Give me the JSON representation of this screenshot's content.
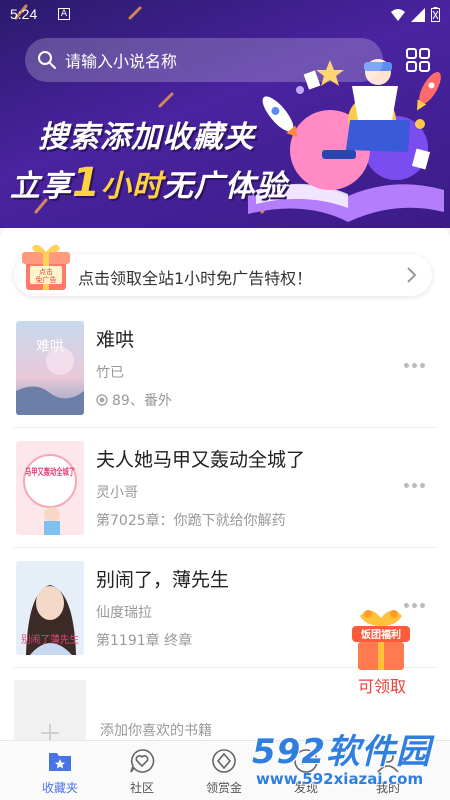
{
  "status_bar": {
    "time": "5:24",
    "notification": "A"
  },
  "search": {
    "placeholder": "请输入小说名称"
  },
  "banner": {
    "line1": "搜索添加收藏夹",
    "line2_prefix": "立享",
    "line2_number": "1",
    "line2_highlight": "小时",
    "line2_suffix": "无广体验"
  },
  "ad_privilege": {
    "badge_top": "点击",
    "badge_bottom": "免广告",
    "text": "点击领取全站1小时免广告特权！"
  },
  "books": [
    {
      "title": "难哄",
      "author": "竹已",
      "progress": "89、番外",
      "cover_text": "难哄"
    },
    {
      "title": "夫人她马甲又轰动全城了",
      "author": "灵小哥",
      "progress": "第7025章：你跪下就给你解药",
      "cover_text": "马甲又轰动全城了"
    },
    {
      "title": "别闹了，薄先生",
      "author": "仙度瑞拉",
      "progress": "第1191章 终章",
      "cover_text": "别闹了薄先生"
    }
  ],
  "add_book": {
    "text": "添加你喜欢的书籍"
  },
  "floating_gift": {
    "badge": "饭团福利",
    "label": "可领取"
  },
  "nav": [
    {
      "label": "收藏夹",
      "icon": "bookmark-folder-icon",
      "active": true
    },
    {
      "label": "社区",
      "icon": "heart-chat-icon",
      "active": false
    },
    {
      "label": "领赏金",
      "icon": "coin-icon",
      "active": false
    },
    {
      "label": "发现",
      "icon": "compass-icon",
      "active": false
    },
    {
      "label": "我的",
      "icon": "user-icon",
      "active": false
    }
  ],
  "watermark": {
    "big": "592软件园",
    "small": "www.592xiazai.com"
  },
  "colors": {
    "banner": "#3a1c86",
    "accent": "#4a74e6",
    "highlight": "#ffd23f",
    "gift_red": "#e8413a"
  }
}
